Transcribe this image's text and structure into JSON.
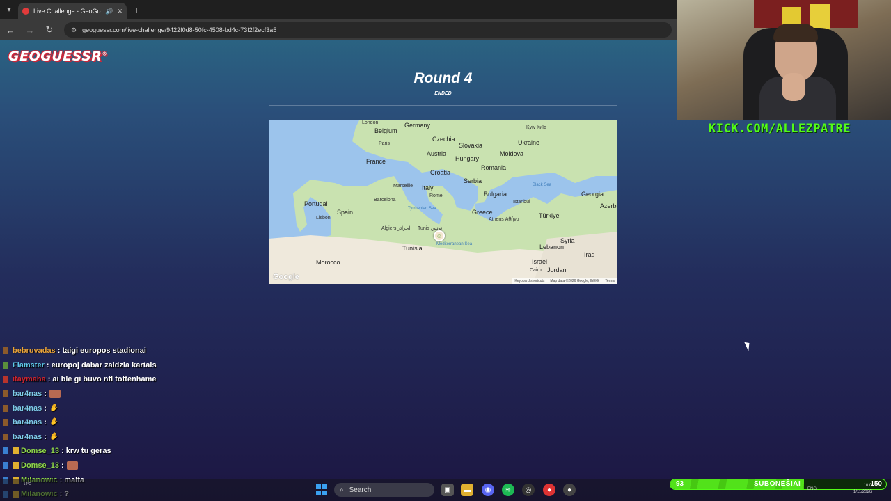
{
  "browser": {
    "tab_title": "Live Challenge - GeoGuessr",
    "new_tab": "+",
    "url": "geoguessr.com/live-challenge/9422f0d8-50fc-4508-bd4c-73f2f2ecf3a5"
  },
  "logo": {
    "text": "GEOGUESSR",
    "reg": "®"
  },
  "round": {
    "title": "Round 4",
    "status": "ENDED"
  },
  "map": {
    "countries": [
      "Belgium",
      "Germany",
      "Czechia",
      "Slovakia",
      "Ukraine",
      "France",
      "Austria",
      "Hungary",
      "Moldova",
      "Croatia",
      "Romania",
      "Italy",
      "Serbia",
      "Portugal",
      "Spain",
      "Bulgaria",
      "Georgia",
      "Greece",
      "Türkiye",
      "Azerb",
      "Tunisia",
      "Syria",
      "Lebanon",
      "Iraq",
      "Morocco",
      "Israel",
      "Jordan"
    ],
    "cities": [
      "London",
      "Paris",
      "Kyiv Київ",
      "Marseille",
      "Rome",
      "Barcelona",
      "Lisbon",
      "Istanbul",
      "Athens Αθήνα",
      "Algiers الجزائر",
      "Tunis تونس",
      "Cairo"
    ],
    "seas": [
      "Black Sea",
      "Tyrrhenian Sea",
      "Mediterranean Sea"
    ],
    "google": "Google",
    "footer": [
      "Keyboard shortcuts",
      "Map data ©2026 Google, INEGI",
      "Terms"
    ]
  },
  "stream": {
    "kick_url": "KICK.COM/ALLEZPATRE",
    "sub_count": "93",
    "sub_label": "SUBONEŠIAI",
    "sub_goal": "150",
    "sub_progress": 0.62
  },
  "chat": [
    {
      "user": "bebruvadas",
      "color": "#e8a33a",
      "msg": ": taigi europos stadionai"
    },
    {
      "user": "Flamster",
      "color": "#5ec7e8",
      "msg": ": europoj dabar zaidzia kartais"
    },
    {
      "user": "itaymaha",
      "color": "#d0232f",
      "msg": ": ai ble gi buvo nfl tottenhame"
    },
    {
      "user": "bar4nas",
      "color": "#7ec9e8",
      "msg": ":"
    },
    {
      "user": "bar4nas",
      "color": "#7ec9e8",
      "msg": ":"
    },
    {
      "user": "bar4nas",
      "color": "#7ec9e8",
      "msg": ":"
    },
    {
      "user": "bar4nas",
      "color": "#7ec9e8",
      "msg": ":"
    },
    {
      "user": "Domse_13",
      "color": "#8ed64a",
      "msg": ": krw tu geras"
    },
    {
      "user": "Domse_13",
      "color": "#8ed64a",
      "msg": ":"
    },
    {
      "user": "Milanowic",
      "color": "#8ed64a",
      "msg": ": malta"
    },
    {
      "user": "Milanowic",
      "color": "#8ed64a",
      "msg": ": ?"
    }
  ],
  "taskbar": {
    "search": "Search",
    "lang": "ENG",
    "time": "10:0",
    "date": "1/11/2026",
    "weather": "-14°C"
  },
  "colors": {
    "kick_green": "#53fc18",
    "logo_red": "#c8283a"
  }
}
